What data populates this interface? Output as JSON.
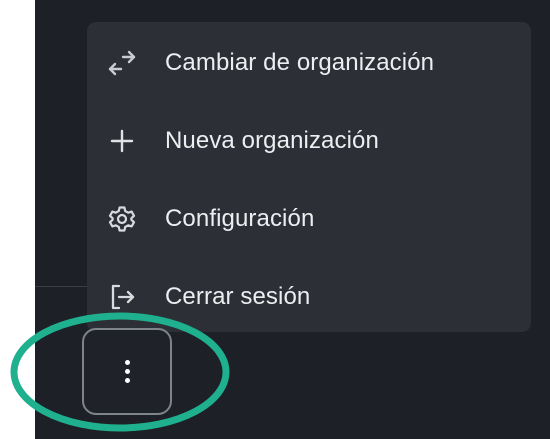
{
  "menu": {
    "items": [
      {
        "label": "Cambiar de organización",
        "icon": "switch-arrows-icon"
      },
      {
        "label": "Nueva organización",
        "icon": "plus-icon"
      },
      {
        "label": "Configuración",
        "icon": "gear-icon"
      },
      {
        "label": "Cerrar sesión",
        "icon": "logout-icon"
      }
    ]
  },
  "more_button": {
    "icon": "vertical-ellipsis-icon"
  },
  "colors": {
    "background": "#1d2026",
    "menu_background": "#2c2f35",
    "text": "#eceef0",
    "highlight": "#1fb08f"
  }
}
